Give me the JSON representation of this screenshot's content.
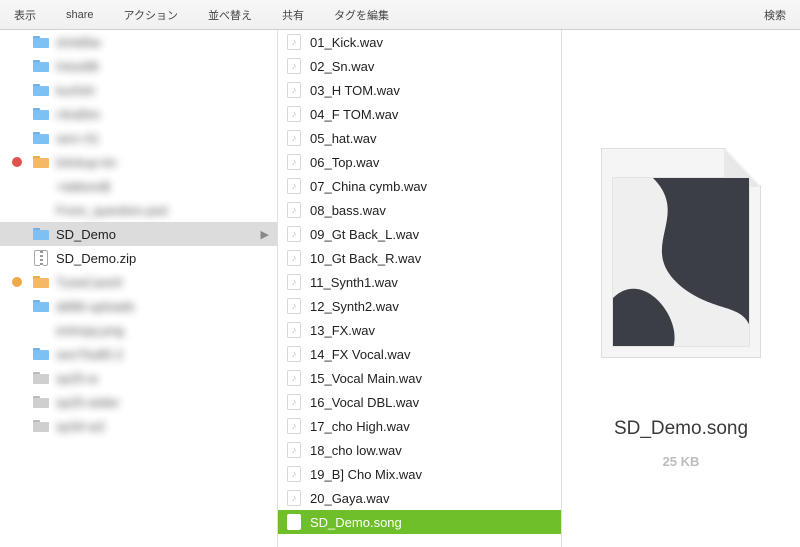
{
  "toolbar": {
    "view": "表示",
    "share": "share",
    "action": "アクション",
    "sort": "並べ替え",
    "shared": "共有",
    "tags": "タグを編集",
    "search": "検索"
  },
  "col1": {
    "blurred": [
      "sh4d0w",
      "h4ze88",
      "kur0sh",
      "r4nd0m",
      "serc-01",
      "b4ckup-tm",
      "+tattoos$",
      "From_question.psd",
      "SD_Demo",
      "SD_Demo.zip",
      "TuneCare®",
      "dd96-uploads",
      "entropy.png",
      "ses70u80.2",
      "sp25-w",
      "sp25-wider",
      "sp34-w2"
    ],
    "selected_index": 8,
    "visible_names": {
      "8": "SD_Demo",
      "9": "SD_Demo.zip"
    },
    "icons": [
      "folder-blue",
      "folder-blue",
      "folder-blue",
      "folder-blue",
      "folder-blue",
      "folder-orange",
      "none",
      "none",
      "folder-blue",
      "zip",
      "folder-orange",
      "folder-blue",
      "none",
      "folder-blue",
      "folder-grey",
      "folder-grey",
      "folder-grey"
    ],
    "markers": {
      "5": "red",
      "10": "orange"
    }
  },
  "col2": {
    "files": [
      "01_Kick.wav",
      "02_Sn.wav",
      "03_H TOM.wav",
      "04_F TOM.wav",
      "05_hat.wav",
      "06_Top.wav",
      "07_China cymb.wav",
      "08_bass.wav",
      "09_Gt Back_L.wav",
      "10_Gt Back_R.wav",
      "11_Synth1.wav",
      "12_Synth2.wav",
      "13_FX.wav",
      "14_FX Vocal.wav",
      "15_Vocal Main.wav",
      "16_Vocal DBL.wav",
      "17_cho High.wav",
      "18_cho low.wav",
      "19_B] Cho Mix.wav",
      "20_Gaya.wav",
      "SD_Demo.song"
    ],
    "selected_index": 20
  },
  "preview": {
    "name": "SD_Demo.song",
    "size": "25 KB"
  }
}
